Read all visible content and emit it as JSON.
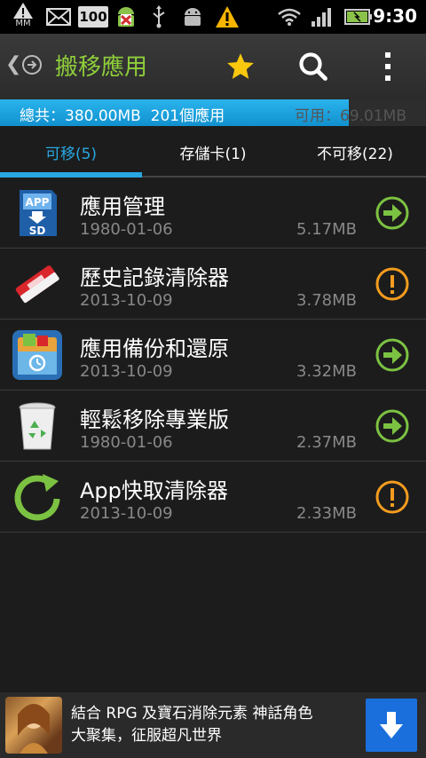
{
  "statusbar": {
    "mm_label": "MM",
    "battery_text": "100",
    "time": "9:30"
  },
  "actionbar": {
    "title": "搬移應用",
    "title_color": "#8fcf3a"
  },
  "storage": {
    "total_text": "總共：380.00MB",
    "apps_text": "201個應用",
    "free_text": "可用：69.01MB",
    "used_fraction": 0.818,
    "accent": "#29a7e1"
  },
  "tabs": [
    {
      "label": "可移(5)",
      "active": true
    },
    {
      "label": "存儲卡(1)",
      "active": false
    },
    {
      "label": "不可移(22)",
      "active": false
    }
  ],
  "apps": [
    {
      "name": "應用管理",
      "date": "1980-01-06",
      "size": "5.17MB",
      "icon": "app-to-sd-icon",
      "action": "move-arrow-icon"
    },
    {
      "name": "歷史記錄清除器",
      "date": "2013-10-09",
      "size": "3.78MB",
      "icon": "eraser-icon",
      "action": "warning-icon"
    },
    {
      "name": "應用備份和還原",
      "date": "2013-10-09",
      "size": "3.32MB",
      "icon": "backup-restore-icon",
      "action": "move-arrow-icon"
    },
    {
      "name": "輕鬆移除專業版",
      "date": "1980-01-06",
      "size": "2.37MB",
      "icon": "recycle-bin-icon",
      "action": "move-arrow-icon"
    },
    {
      "name": "App快取清除器",
      "date": "2013-10-09",
      "size": "2.33MB",
      "icon": "refresh-arrow-icon",
      "action": "warning-icon"
    }
  ],
  "ad": {
    "line1": "結合 RPG 及寶石消除元素 神話角色",
    "line2": "大聚集，征服超凡世界"
  }
}
